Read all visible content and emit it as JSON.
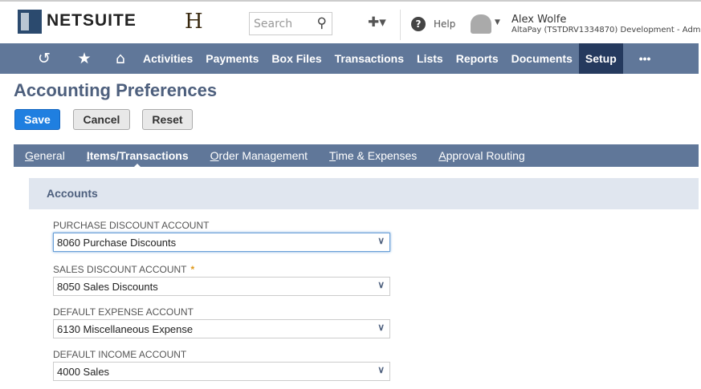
{
  "header": {
    "logo": "NETSUITE",
    "brand_mark": "H",
    "search_placeholder": "Search",
    "help": "Help",
    "user_name": "Alex Wolfe",
    "user_account": "AltaPay (TSTDRV1334870) Development - Adm"
  },
  "nav": {
    "items": [
      "Activities",
      "Payments",
      "Box Files",
      "Transactions",
      "Lists",
      "Reports",
      "Documents",
      "Setup"
    ],
    "more": "•••"
  },
  "page": {
    "title": "Accounting Preferences",
    "save": "Save",
    "cancel": "Cancel",
    "reset": "Reset"
  },
  "tabs": [
    {
      "u": "G",
      "rest": "eneral"
    },
    {
      "u": "I",
      "rest": "tems/Transactions"
    },
    {
      "u": "O",
      "rest": "rder Management"
    },
    {
      "u": "T",
      "rest": "ime & Expenses"
    },
    {
      "u": "A",
      "rest": "pproval Routing"
    }
  ],
  "section": "Accounts",
  "fields": [
    {
      "label": "PURCHASE DISCOUNT ACCOUNT",
      "value": "8060 Purchase Discounts"
    },
    {
      "label": "SALES DISCOUNT ACCOUNT",
      "value": "8050 Sales Discounts",
      "required": "*"
    },
    {
      "label": "DEFAULT EXPENSE ACCOUNT",
      "value": "6130 Miscellaneous Expense"
    },
    {
      "label": "DEFAULT INCOME ACCOUNT",
      "value": "4000 Sales"
    }
  ]
}
